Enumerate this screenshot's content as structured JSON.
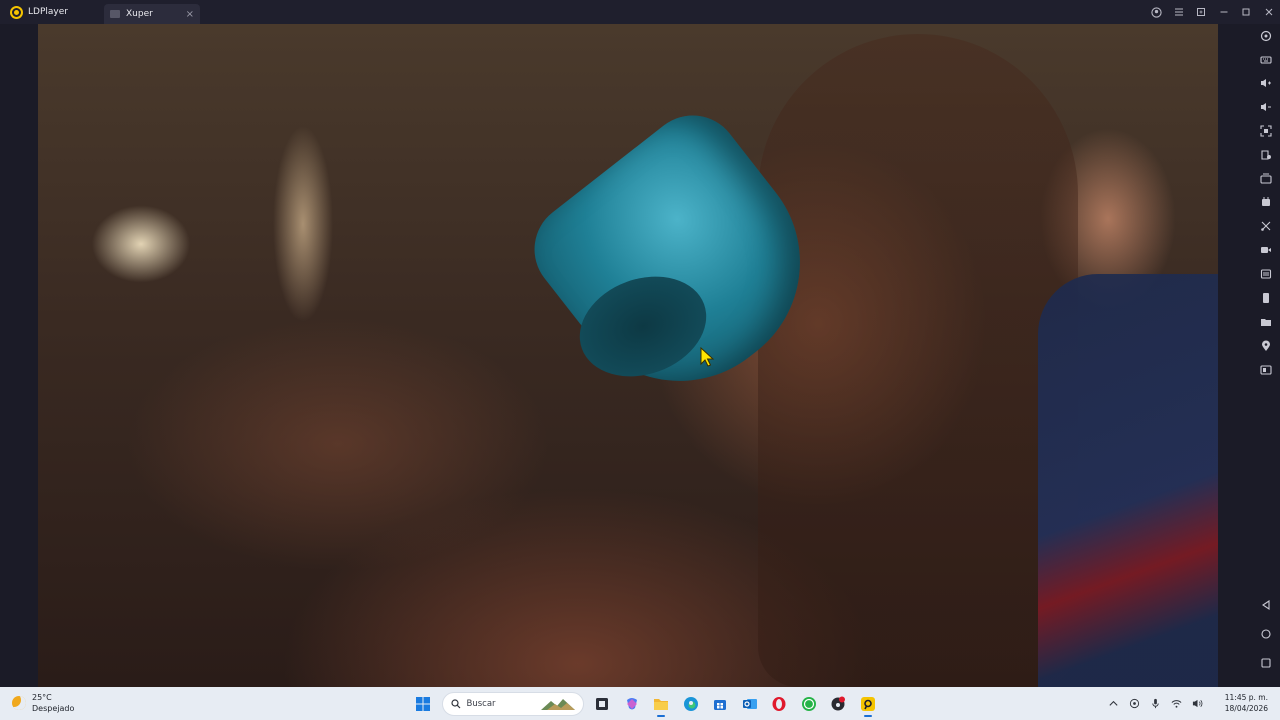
{
  "window": {
    "app_name": "LDPlayer",
    "tab": {
      "label": "Xuper",
      "close": "×"
    },
    "controls": [
      "account-icon",
      "menu-icon",
      "restore-icon",
      "minimize-icon",
      "maximize-icon",
      "close-icon"
    ]
  },
  "toolbar": {
    "tools": [
      "gamepad-icon",
      "keyboard-icon",
      "volume-up-icon",
      "volume-down-icon",
      "screenshot-icon",
      "gallery-icon",
      "multi-instance-icon",
      "sync-icon",
      "scissors-icon",
      "record-icon",
      "apk-install-icon",
      "shake-icon",
      "folder-icon",
      "location-icon",
      "operation-record-icon"
    ],
    "nav": [
      "back-icon",
      "home-icon",
      "recents-icon"
    ]
  },
  "taskbar": {
    "weather": {
      "temp": "25°C",
      "desc": "Despejado"
    },
    "search_placeholder": "Buscar",
    "apps": [
      "start-icon",
      "search",
      "file-explorer-icon",
      "copilot-icon",
      "folder-icon",
      "edge-icon",
      "store-icon",
      "outlook-icon",
      "opera-icon",
      "whatsapp-icon",
      "app-icon",
      "ldplayer-icon"
    ],
    "tray": [
      "chevron-up-icon",
      "network-icon",
      "microphone-icon",
      "wifi-icon",
      "volume-icon"
    ],
    "clock": {
      "time": "11:45 p. m.",
      "date": "18/04/2026"
    }
  },
  "colors": {
    "accent": "#f5c400",
    "taskbar_bg": "#e7ecf3",
    "frame_bg": "#1b1b27"
  }
}
